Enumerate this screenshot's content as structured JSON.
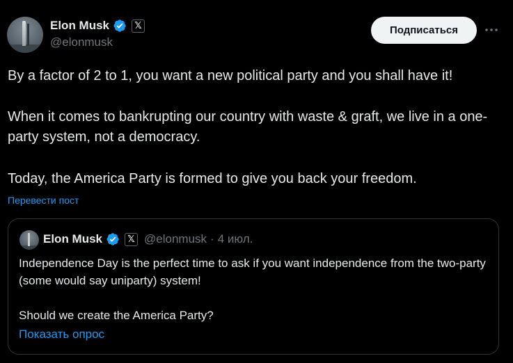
{
  "author": {
    "name": "Elon Musk",
    "handle": "@elonmusk",
    "affiliate_badge": "𝕏"
  },
  "follow_button": "Подписаться",
  "more_icon": "more-horizontal-icon",
  "post": {
    "line1": "By a factor of 2 to 1, you want a new political party and you shall have it!",
    "line2": "When it comes to bankrupting our country with waste & graft, we live in a one-party system, not a democracy.",
    "line3": "Today, the America Party is formed to give you back your freedom."
  },
  "translate_link": "Перевести пост",
  "quoted": {
    "name": "Elon Musk",
    "affiliate_badge": "𝕏",
    "handle": "@elonmusk",
    "separator": "·",
    "date": "4 июл.",
    "text1": "Independence Day is the perfect time to ask if you want independence from the two-party (some would say uniparty) system!",
    "text2": "Should we create the America Party?",
    "show_poll": "Показать опрос"
  },
  "colors": {
    "background": "#000000",
    "text": "#e7e9ea",
    "muted": "#71767b",
    "link": "#1d9bf0",
    "verified": "#1d9bf0",
    "border": "#2f3336"
  }
}
